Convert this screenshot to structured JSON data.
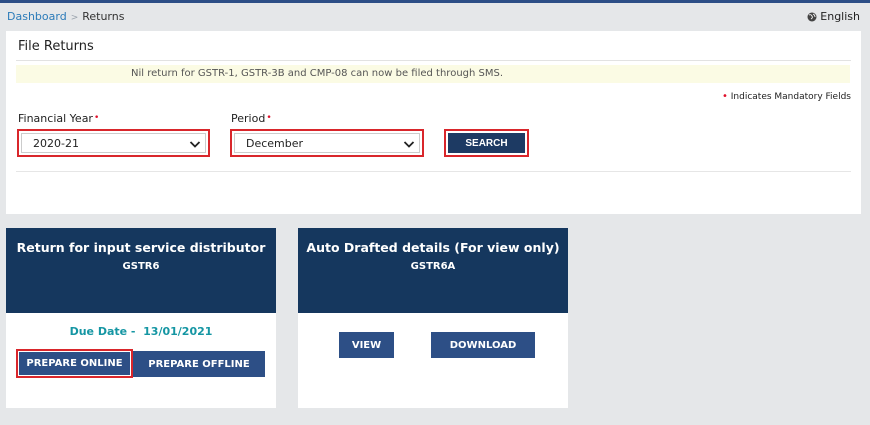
{
  "breadcrumb": {
    "home": "Dashboard",
    "separator": ">",
    "current": "Returns"
  },
  "language": {
    "label": "English",
    "icon": "globe-icon"
  },
  "panel": {
    "title": "File Returns",
    "notice": "Nil return for GSTR-1, GSTR-3B and CMP-08 can now be filed through SMS.",
    "mandatory_marker": "•",
    "mandatory_text": "Indicates Mandatory Fields",
    "financial_year": {
      "label": "Financial Year",
      "required_marker": "•",
      "value": "2020-21"
    },
    "period": {
      "label": "Period",
      "required_marker": "•",
      "value": "December"
    },
    "search_label": "SEARCH"
  },
  "cards": [
    {
      "title": "Return for input service distributor",
      "subtitle": "GSTR6",
      "due_label": "Due Date -",
      "due_date": "13/01/2021",
      "primary_button": "PREPARE ONLINE",
      "secondary_button": "PREPARE OFFLINE"
    },
    {
      "title": "Auto Drafted details (For view only)",
      "subtitle": "GSTR6A",
      "primary_button": "VIEW",
      "secondary_button": "DOWNLOAD"
    }
  ],
  "colors": {
    "header_navy": "#15375e",
    "button_blue": "#2d4f86",
    "highlight_red": "#d9262b",
    "due_teal": "#1596a3",
    "page_bg": "#e5e7e9"
  }
}
